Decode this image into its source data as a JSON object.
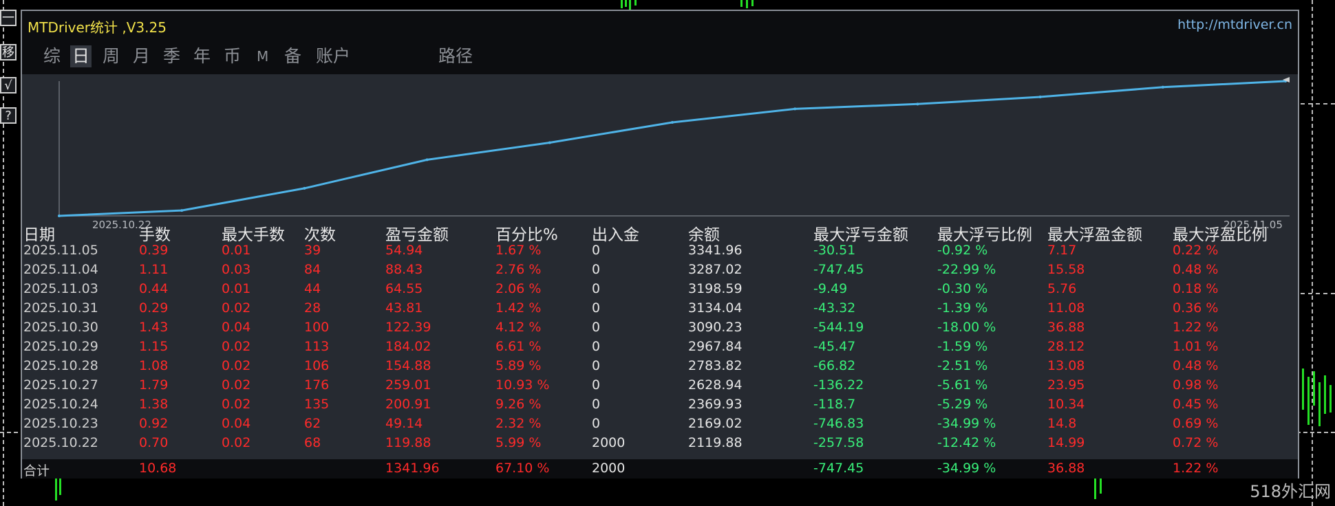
{
  "window": {
    "title": "MTDriver统计 ,V3.25",
    "link": "http://mtdriver.cn"
  },
  "tabs": [
    {
      "label": "综",
      "active": false
    },
    {
      "label": "日",
      "active": true
    },
    {
      "label": "周",
      "active": false
    },
    {
      "label": "月",
      "active": false
    },
    {
      "label": "季",
      "active": false
    },
    {
      "label": "年",
      "active": false
    },
    {
      "label": "币",
      "active": false
    },
    {
      "label": "M",
      "active": false
    },
    {
      "label": "备",
      "active": false
    },
    {
      "label": "账户",
      "active": false
    },
    {
      "label": "路径",
      "active": false
    }
  ],
  "side_buttons": [
    "一",
    "移",
    "√",
    "?"
  ],
  "chart_data": {
    "type": "line",
    "x": [
      "2025.10.22",
      "2025.10.23",
      "2025.10.24",
      "2025.10.27",
      "2025.10.28",
      "2025.10.29",
      "2025.10.30",
      "2025.10.31",
      "2025.11.03",
      "2025.11.04",
      "2025.11.05"
    ],
    "series": [
      {
        "values": [
          2119.88,
          2169.02,
          2369.93,
          2628.94,
          2783.82,
          2967.84,
          3090.23,
          3134.04,
          3198.59,
          3287.02,
          3341.96
        ]
      }
    ],
    "x_start_label": "2025.10.22",
    "x_end_label": "2025.11.05",
    "line_color": "#4fb4e8"
  },
  "table": {
    "headers": [
      "日期",
      "手数",
      "最大手数",
      "次数",
      "盈亏金额",
      "百分比%",
      "出入金",
      "余额",
      "最大浮亏金额",
      "最大浮亏比例",
      "最大浮盈金额",
      "最大浮盈比例"
    ],
    "rows": [
      [
        "2025.11.05",
        "0.39",
        "0.01",
        "39",
        "54.94",
        "1.67 %",
        "0",
        "3341.96",
        "-30.51",
        "-0.92 %",
        "7.17",
        "0.22 %"
      ],
      [
        "2025.11.04",
        "1.11",
        "0.03",
        "84",
        "88.43",
        "2.76 %",
        "0",
        "3287.02",
        "-747.45",
        "-22.99 %",
        "15.58",
        "0.48 %"
      ],
      [
        "2025.11.03",
        "0.44",
        "0.01",
        "44",
        "64.55",
        "2.06 %",
        "0",
        "3198.59",
        "-9.49",
        "-0.30 %",
        "5.76",
        "0.18 %"
      ],
      [
        "2025.10.31",
        "0.29",
        "0.02",
        "28",
        "43.81",
        "1.42 %",
        "0",
        "3134.04",
        "-43.32",
        "-1.39 %",
        "11.08",
        "0.36 %"
      ],
      [
        "2025.10.30",
        "1.43",
        "0.04",
        "100",
        "122.39",
        "4.12 %",
        "0",
        "3090.23",
        "-544.19",
        "-18.00 %",
        "36.88",
        "1.22 %"
      ],
      [
        "2025.10.29",
        "1.15",
        "0.02",
        "113",
        "184.02",
        "6.61 %",
        "0",
        "2967.84",
        "-45.47",
        "-1.59 %",
        "28.12",
        "1.01 %"
      ],
      [
        "2025.10.28",
        "1.08",
        "0.02",
        "106",
        "154.88",
        "5.89 %",
        "0",
        "2783.82",
        "-66.82",
        "-2.51 %",
        "13.08",
        "0.48 %"
      ],
      [
        "2025.10.27",
        "1.79",
        "0.02",
        "176",
        "259.01",
        "10.93 %",
        "0",
        "2628.94",
        "-136.22",
        "-5.61 %",
        "23.95",
        "0.98 %"
      ],
      [
        "2025.10.24",
        "1.38",
        "0.02",
        "135",
        "200.91",
        "9.26 %",
        "0",
        "2369.93",
        "-118.7",
        "-5.29 %",
        "10.34",
        "0.45 %"
      ],
      [
        "2025.10.23",
        "0.92",
        "0.04",
        "62",
        "49.14",
        "2.32 %",
        "0",
        "2169.02",
        "-746.83",
        "-34.99 %",
        "14.8",
        "0.69 %"
      ],
      [
        "2025.10.22",
        "0.70",
        "0.02",
        "68",
        "119.88",
        "5.99 %",
        "2000",
        "2119.88",
        "-257.58",
        "-12.42 %",
        "14.99",
        "0.72 %"
      ]
    ],
    "total": [
      "合计",
      "10.68",
      "",
      "",
      "1341.96",
      "67.10 %",
      "2000",
      "",
      "-747.45",
      "-34.99 %",
      "36.88",
      "1.22 %"
    ]
  },
  "watermark": "518外汇网",
  "colors": {
    "positive": "#ff2a2a",
    "negative": "#39f07a",
    "title": "#f2e24a",
    "link": "#7fb7e6",
    "panel": "#262a31"
  }
}
